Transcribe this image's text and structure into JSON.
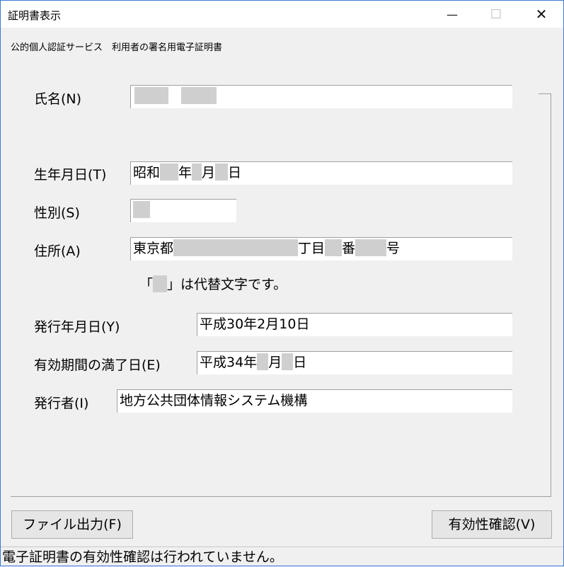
{
  "window": {
    "title": "証明書表示",
    "minimize_glyph": "—",
    "maximize_glyph": "☐",
    "close_glyph": "✕"
  },
  "subtitle": "公的個人認証サービス　利用者の署名用電子証明書",
  "fields": {
    "name_label": "氏名(N)",
    "birth_label": "生年月日(T)",
    "birth_era": "昭和",
    "birth_year_suffix": "年",
    "birth_month_suffix": "月",
    "birth_day_suffix": "日",
    "sex_label": "性別(S)",
    "address_label": "住所(A)",
    "address_prefix": "東京都",
    "address_chome": "丁目",
    "address_ban": "番",
    "address_go": "号",
    "substitute_note_open": "「",
    "substitute_note_close": "」は代替文字です。",
    "issue_date_label": "発行年月日(Y)",
    "issue_date_value": "平成30年2月10日",
    "expiry_label": "有効期間の満了日(E)",
    "expiry_prefix": "平成34年",
    "expiry_month_suffix": "月",
    "expiry_day_suffix": "日",
    "issuer_label": "発行者(I)",
    "issuer_value": "地方公共団体情報システム機構"
  },
  "buttons": {
    "file_output": "ファイル出力(F)",
    "validity_check": "有効性確認(V)"
  },
  "status_bar": "電子証明書の有効性確認は行われていません。"
}
